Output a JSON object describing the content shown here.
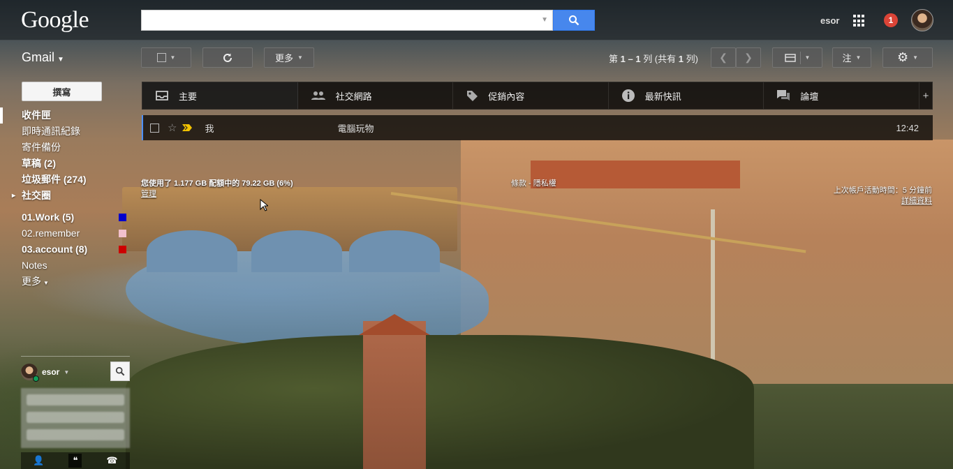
{
  "header": {
    "logo": "Google",
    "search": {
      "value": "",
      "placeholder": ""
    },
    "user_name": "esor",
    "notification_count": "1"
  },
  "toolbar": {
    "app_label": "Gmail",
    "more_label": "更多",
    "pager": {
      "prefix": "第",
      "range": "1 – 1",
      "mid": "列 (共有",
      "total": "1",
      "suffix": "列)"
    },
    "input_tool_label": "注"
  },
  "sidebar": {
    "compose_label": "撰寫",
    "items": [
      {
        "label": "收件匣",
        "bold": true,
        "active": true
      },
      {
        "label": "即時通訊紀錄"
      },
      {
        "label": "寄件備份"
      },
      {
        "label": "草稿 (2)",
        "bold": true
      },
      {
        "label": "垃圾郵件 (274)",
        "bold": true
      },
      {
        "label": "社交圈",
        "bold": true,
        "arrow": true
      }
    ],
    "labels": [
      {
        "label": "01.Work (5)",
        "bold": true,
        "color": "#0000cc"
      },
      {
        "label": "02.remember",
        "color": "#f2c0cc"
      },
      {
        "label": "03.account (8)",
        "bold": true,
        "color": "#cc0000"
      },
      {
        "label": "Notes"
      }
    ],
    "more_label": "更多"
  },
  "tabs": [
    {
      "label": "主要",
      "icon": "inbox-icon"
    },
    {
      "label": "社交網路",
      "icon": "people-icon"
    },
    {
      "label": "促銷內容",
      "icon": "tag-icon"
    },
    {
      "label": "最新快訊",
      "icon": "info-icon"
    },
    {
      "label": "論壇",
      "icon": "forum-icon"
    }
  ],
  "emails": [
    {
      "sender": "我",
      "subject": "電腦玩物",
      "time": "12:42"
    }
  ],
  "footer": {
    "storage": "您使用了 1.177 GB 配額中的 79.22 GB (6%)",
    "manage": "管理",
    "policy": "條款 - 隱私權",
    "last_activity": "上次帳戶活動時間：5 分鐘前",
    "details": "詳細資料"
  },
  "chat": {
    "user": "esor"
  },
  "colors": {
    "search_button": "#4787ed",
    "notification": "#db4437",
    "online": "#0f9d58"
  }
}
